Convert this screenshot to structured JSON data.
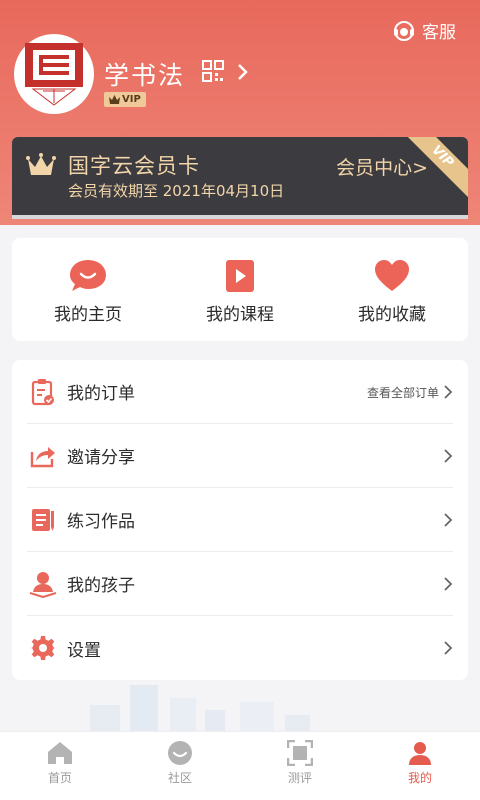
{
  "header": {
    "customer_service_label": "客服",
    "username": "学书法",
    "vip_tag": "VIP"
  },
  "member_card": {
    "title": "国字云会员卡",
    "validity": "会员有效期至 2021年04月10日",
    "center_link": "会员中心>",
    "ribbon": "VIP"
  },
  "quick_actions": [
    {
      "label": "我的主页",
      "icon": "chat-bubble-icon"
    },
    {
      "label": "我的课程",
      "icon": "play-book-icon"
    },
    {
      "label": "我的收藏",
      "icon": "heart-icon"
    }
  ],
  "menu": [
    {
      "label": "我的订单",
      "icon": "order-clipboard-icon",
      "right_text": "查看全部订单"
    },
    {
      "label": "邀请分享",
      "icon": "share-icon",
      "right_text": ""
    },
    {
      "label": "练习作品",
      "icon": "notebook-icon",
      "right_text": ""
    },
    {
      "label": "我的孩子",
      "icon": "child-user-icon",
      "right_text": ""
    },
    {
      "label": "设置",
      "icon": "settings-gear-icon",
      "right_text": ""
    }
  ],
  "tabs": [
    {
      "label": "首页",
      "icon": "home-icon",
      "active": false
    },
    {
      "label": "社区",
      "icon": "community-icon",
      "active": false
    },
    {
      "label": "测评",
      "icon": "scan-icon",
      "active": false
    },
    {
      "label": "我的",
      "icon": "profile-icon",
      "active": true
    }
  ],
  "colors": {
    "accent": "#e8695c",
    "gold": "#f2d5a8",
    "card_bg": "#3b3b40",
    "tab_active": "#e45c4e"
  }
}
